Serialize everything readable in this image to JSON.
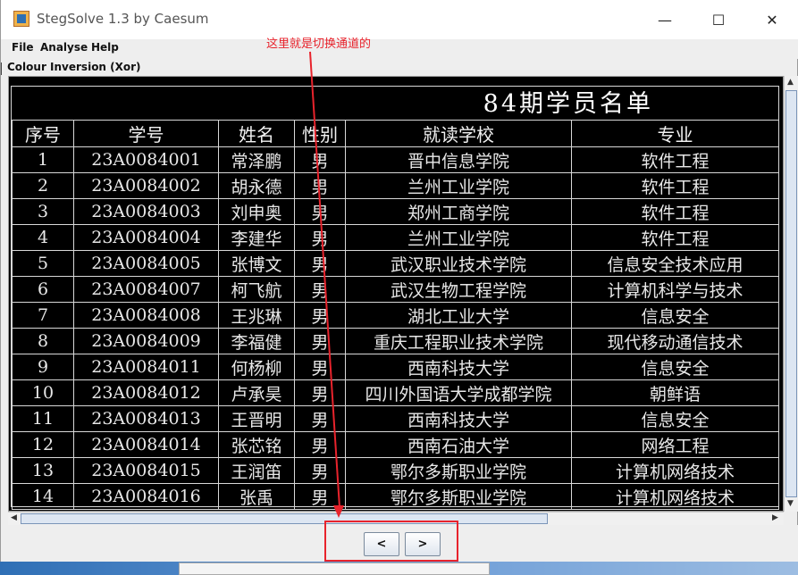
{
  "window": {
    "title": "StegSolve 1.3 by Caesum"
  },
  "controls": {
    "minimize": "—",
    "maximize": "☐",
    "close": "✕"
  },
  "menu": {
    "items": [
      "File",
      "Analyse",
      "Help"
    ]
  },
  "caption": "Colour Inversion (Xor)",
  "annotation": "这里就是切换通道的",
  "nav": {
    "prev": "<",
    "next": ">"
  },
  "poster": {
    "title": "84期学员名单",
    "headers": [
      "序号",
      "学号",
      "姓名",
      "性别",
      "就读学校",
      "专业"
    ],
    "rows": [
      [
        "1",
        "23A0084001",
        "常泽鹏",
        "男",
        "晋中信息学院",
        "软件工程"
      ],
      [
        "2",
        "23A0084002",
        "胡永德",
        "男",
        "兰州工业学院",
        "软件工程"
      ],
      [
        "3",
        "23A0084003",
        "刘申奥",
        "男",
        "郑州工商学院",
        "软件工程"
      ],
      [
        "4",
        "23A0084004",
        "李建华",
        "男",
        "兰州工业学院",
        "软件工程"
      ],
      [
        "5",
        "23A0084005",
        "张博文",
        "男",
        "武汉职业技术学院",
        "信息安全技术应用"
      ],
      [
        "6",
        "23A0084007",
        "柯飞航",
        "男",
        "武汉生物工程学院",
        "计算机科学与技术"
      ],
      [
        "7",
        "23A0084008",
        "王兆琳",
        "男",
        "湖北工业大学",
        "信息安全"
      ],
      [
        "8",
        "23A0084009",
        "李福健",
        "男",
        "重庆工程职业技术学院",
        "现代移动通信技术"
      ],
      [
        "9",
        "23A0084011",
        "何杨柳",
        "男",
        "西南科技大学",
        "信息安全"
      ],
      [
        "10",
        "23A0084012",
        "卢承昊",
        "男",
        "四川外国语大学成都学院",
        "朝鲜语"
      ],
      [
        "11",
        "23A0084013",
        "王晋明",
        "男",
        "西南科技大学",
        "信息安全"
      ],
      [
        "12",
        "23A0084014",
        "张芯铭",
        "男",
        "西南石油大学",
        "网络工程"
      ],
      [
        "13",
        "23A0084015",
        "王润笛",
        "男",
        "鄂尔多斯职业学院",
        "计算机网络技术"
      ],
      [
        "14",
        "23A0084016",
        "张禹",
        "男",
        "鄂尔多斯职业学院",
        "计算机网络技术"
      ]
    ]
  }
}
